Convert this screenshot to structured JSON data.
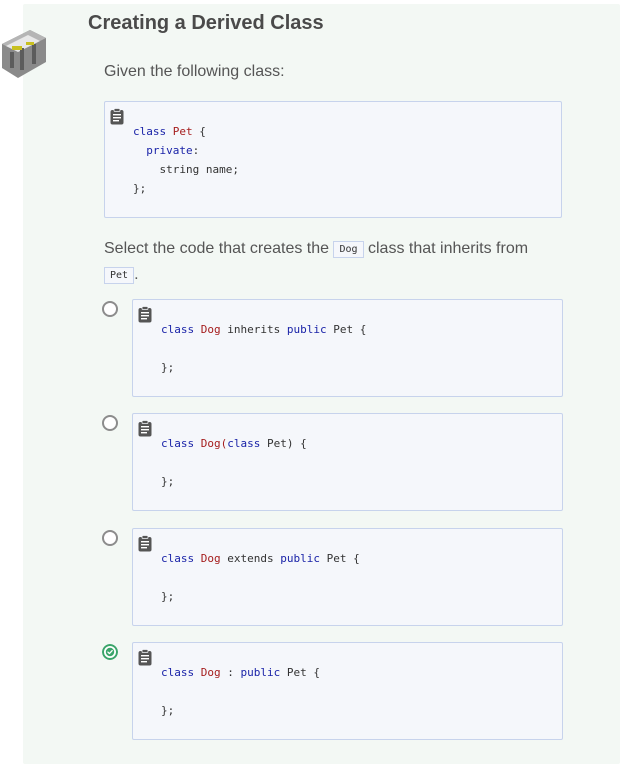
{
  "header": {
    "title": "Creating a Derived Class"
  },
  "intro": "Given the following class:",
  "given_code": [
    "class Pet {",
    "  private:",
    "    string name;",
    "};"
  ],
  "question": {
    "before": "Select the code that creates the",
    "code1": "Dog",
    "middle": "class that inherits from",
    "code2": "Pet",
    "after": "."
  },
  "options": [
    {
      "kw1": "class",
      "cls": "Dog",
      "rest1": " inherits ",
      "kw2": "public",
      "rest2": " Pet {",
      "close": "};",
      "selected": false
    },
    {
      "kw1": "class",
      "cls": "Dog(",
      "rest1": "",
      "kw2": "class",
      "rest2": " Pet) {",
      "close": "};",
      "selected": false
    },
    {
      "kw1": "class",
      "cls": "Dog",
      "rest1": " extends ",
      "kw2": "public",
      "rest2": " Pet {",
      "close": "};",
      "selected": false
    },
    {
      "kw1": "class",
      "cls": "Dog",
      "rest1": " : ",
      "kw2": "public",
      "rest2": " Pet {",
      "close": "};",
      "selected": true
    }
  ],
  "colors": {
    "keyword": "#1a23a8",
    "classname": "#a51d1d",
    "correct": "#3aa56a"
  },
  "icons": {
    "clip": "clipboard-icon",
    "logo": "codio-logo-icon"
  }
}
